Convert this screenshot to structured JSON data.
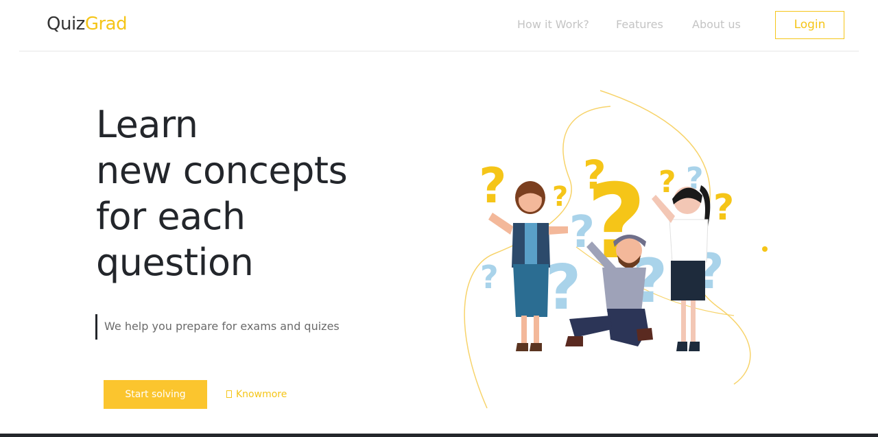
{
  "brand": {
    "part1": "Quiz",
    "part2": "Grad"
  },
  "nav": {
    "links": [
      "How it Work?",
      "Features",
      "About us"
    ],
    "login_label": "Login"
  },
  "hero": {
    "title_lines": [
      "Learn",
      "new concepts",
      "for each",
      "question"
    ],
    "tagline": "We help you prepare for exams and quizes",
    "primary_cta": "Start solving",
    "secondary_cta": "Knowmore"
  },
  "colors": {
    "accent": "#f5c518",
    "button_fill": "#fbc52e",
    "text_dark": "#23262b",
    "nav_muted": "#c4c4c4",
    "question_blue": "#a9d3ea"
  },
  "icons": {
    "knowmore": "missing-glyph-box-icon"
  }
}
